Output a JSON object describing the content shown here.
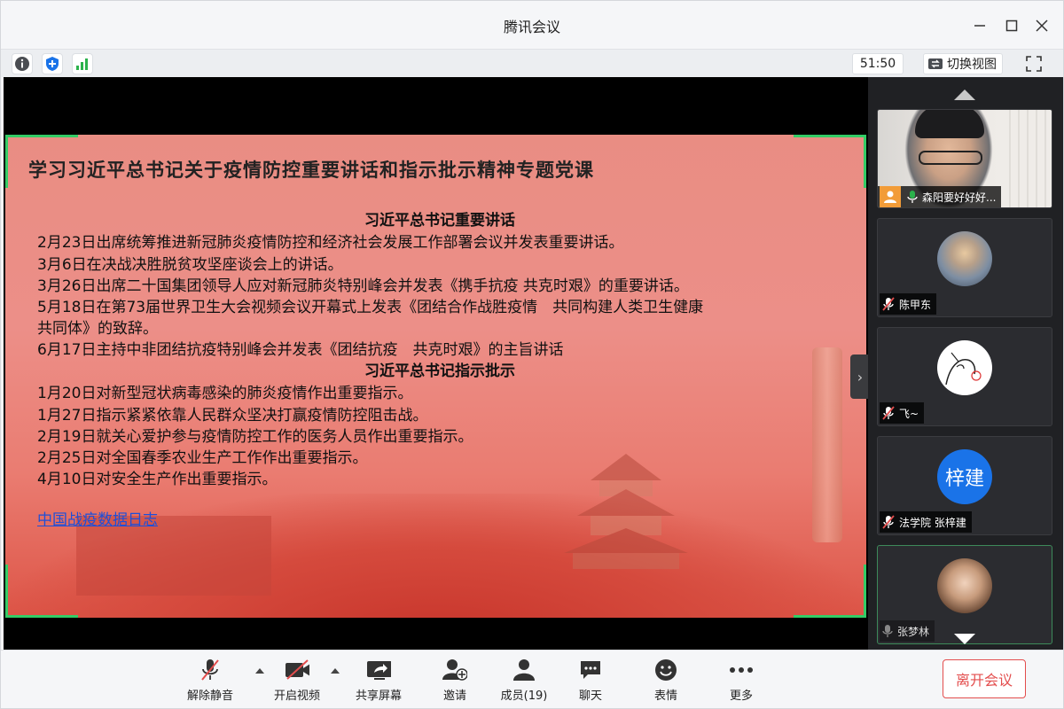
{
  "window": {
    "title": "腾讯会议"
  },
  "infobar": {
    "timer": "51:50",
    "switch_view_label": "切换视图"
  },
  "slide": {
    "title": "学习习近平总书记关于疫情防控重要讲话和指示批示精神专题党课",
    "section1_heading": "习近平总书记重要讲话",
    "section1_lines": [
      "2月23日出席统筹推进新冠肺炎疫情防控和经济社会发展工作部署会议并发表重要讲话。",
      "3月6日在决战决胜脱贫攻坚座谈会上的讲话。",
      "3月26日出席二十国集团领导人应对新冠肺炎特别峰会并发表《携手抗疫 共克时艰》的重要讲话。",
      "5月18日在第73届世界卫生大会视频会议开幕式上发表《团结合作战胜疫情　共同构建人类卫生健康",
      "共同体》的致辞。",
      "6月17日主持中非团结抗疫特别峰会并发表《团结抗疫　共克时艰》的主旨讲话"
    ],
    "section2_heading": "习近平总书记指示批示",
    "section2_lines": [
      "1月20日对新型冠状病毒感染的肺炎疫情作出重要指示。",
      "1月27日指示紧紧依靠人民群众坚决打赢疫情防控阻击战。",
      "2月19日就关心爱护参与疫情防控工作的医务人员作出重要指示。",
      "2月25日对全国春季农业生产工作作出重要指示。",
      "4月10日对安全生产作出重要指示。"
    ],
    "link_text": "中国战疫数据日志"
  },
  "participants": [
    {
      "name": "森阳要好好好...",
      "type": "camera",
      "muted": false,
      "host": true
    },
    {
      "name": "陈甲东",
      "type": "photo",
      "muted": true
    },
    {
      "name": "飞~",
      "type": "sketch",
      "muted": true
    },
    {
      "name": "法学院 张梓建",
      "type": "text",
      "avatar_text": "梓建",
      "muted": true
    },
    {
      "name": "张梦林",
      "type": "photo2",
      "muted": false,
      "active": true
    }
  ],
  "toolbar": {
    "unmute": "解除静音",
    "start_video": "开启视频",
    "share_screen": "共享屏幕",
    "invite": "邀请",
    "members": "成员(19)",
    "chat": "聊天",
    "emoji": "表情",
    "more": "更多",
    "leave": "离开会议"
  },
  "colors": {
    "accent_red": "#e34d4d",
    "frame_green": "#33cc66",
    "avatar_blue": "#1a73e8",
    "host_orange": "#f29c38"
  }
}
